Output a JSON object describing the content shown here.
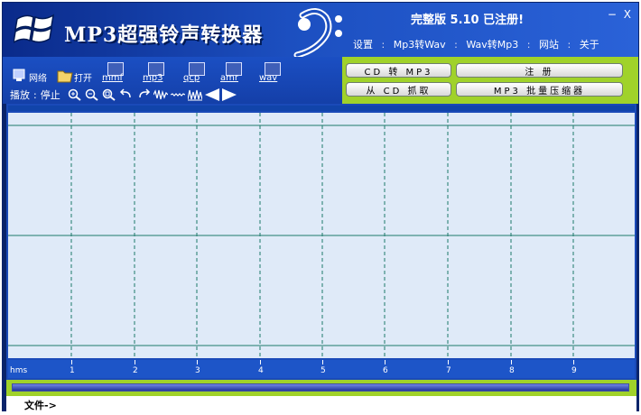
{
  "header": {
    "app_title": "MP3超强铃声转换器",
    "version": "完整版 5.10 已注册!",
    "minimize": "−",
    "close": "X"
  },
  "top_menu": {
    "items": [
      "设置",
      "Mp3转Wav",
      "Wav转Mp3",
      "网站",
      "关于"
    ],
    "separator": ":"
  },
  "toolbar": {
    "network_label": "网络",
    "open_label": "打开",
    "formats": [
      "mmf",
      "mp3",
      "qcp",
      "amr",
      "wav"
    ],
    "play_label": "播放",
    "stop_label": "停止",
    "play_sep": ":"
  },
  "right_buttons": {
    "cd_to_mp3": "CD 转 MP3",
    "register": "注 册",
    "grab_cd": "从 CD 抓取",
    "batch_compress": "MP3 批量压缩器"
  },
  "ruler": {
    "unit": "hms",
    "ticks": [
      "1",
      "2",
      "3",
      "4",
      "5",
      "6",
      "7",
      "8",
      "9"
    ]
  },
  "status": {
    "text": "文件->"
  },
  "colors": {
    "frame_blue": "#1a4ab8",
    "accent_green": "#a0d22a",
    "wave_bg": "#dfeaf8",
    "grid": "#1e7a6a"
  }
}
